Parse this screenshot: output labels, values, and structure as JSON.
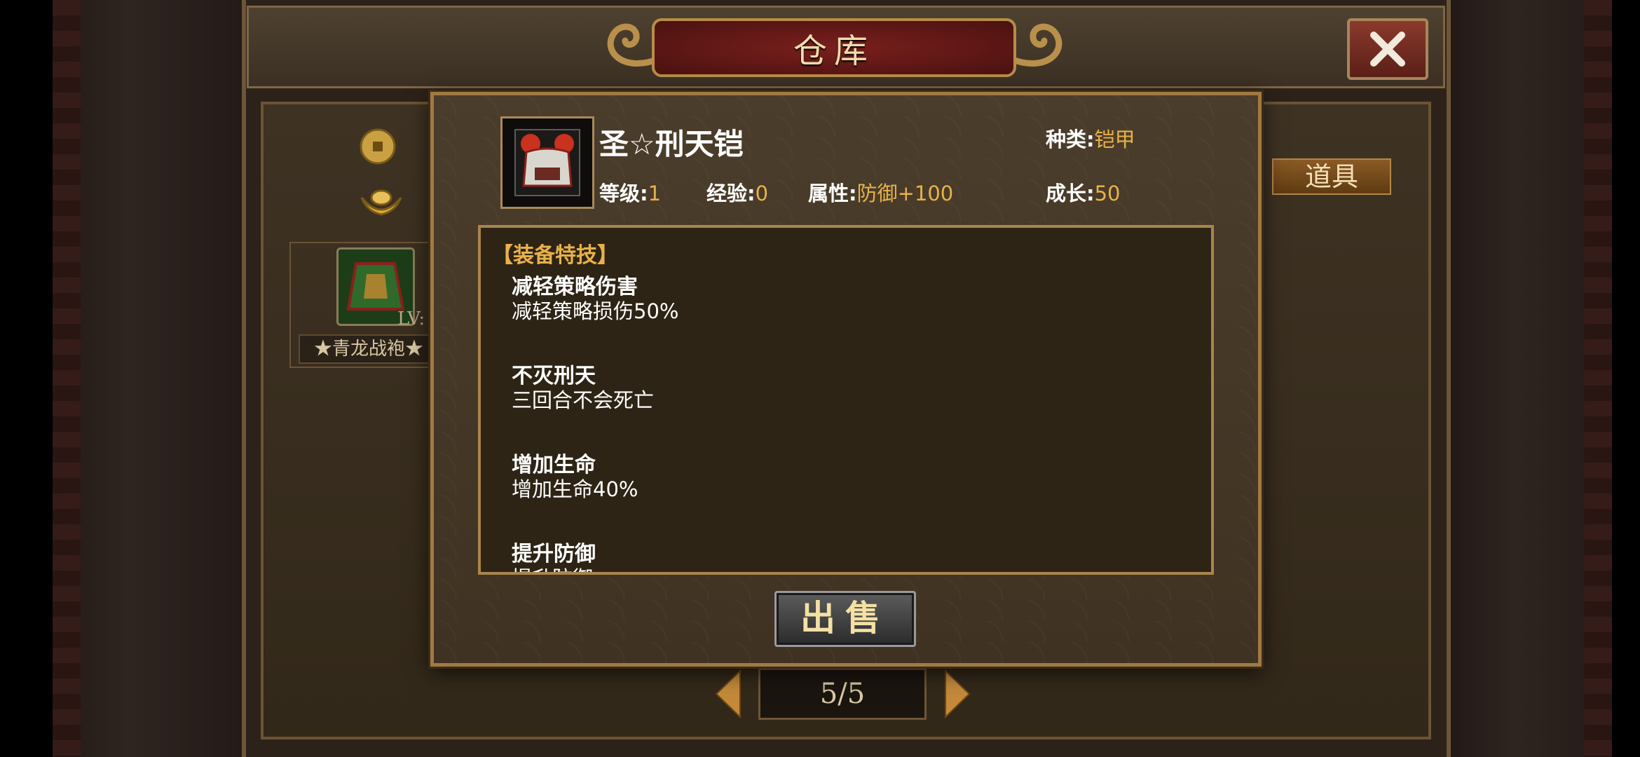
{
  "window": {
    "title": "仓库",
    "close_symbol": "✕"
  },
  "sidebar": {
    "icons": [
      "coin-icon",
      "ingot-icon"
    ]
  },
  "inventory": {
    "slot": {
      "name": "★青龙战袍★",
      "level_prefix": "LV:"
    },
    "tab_label": "道具"
  },
  "pager": {
    "text": "5/5"
  },
  "dialog": {
    "item_name": "圣☆刑天铠",
    "category_label": "种类:",
    "category_value": "铠甲",
    "level_label": "等级:",
    "level_value": "1",
    "exp_label": "经验:",
    "exp_value": "0",
    "attr_label": "属性:",
    "attr_value": "防御+100",
    "growth_label": "成长:",
    "growth_value": "50",
    "skills_title": "【装备特技】",
    "skills": [
      {
        "name": "减轻策略伤害",
        "desc": "减轻策略损伤50%"
      },
      {
        "name": "不灭刑天",
        "desc": "三回合不会死亡"
      },
      {
        "name": "增加生命",
        "desc": "增加生命40%"
      },
      {
        "name": "提升防御",
        "desc": "提升防御"
      }
    ],
    "sell_label": "出售"
  },
  "colors": {
    "value_gold": "#e8b24a",
    "frame_gold": "#a07a43",
    "plaque_red": "#7a1f1c"
  }
}
